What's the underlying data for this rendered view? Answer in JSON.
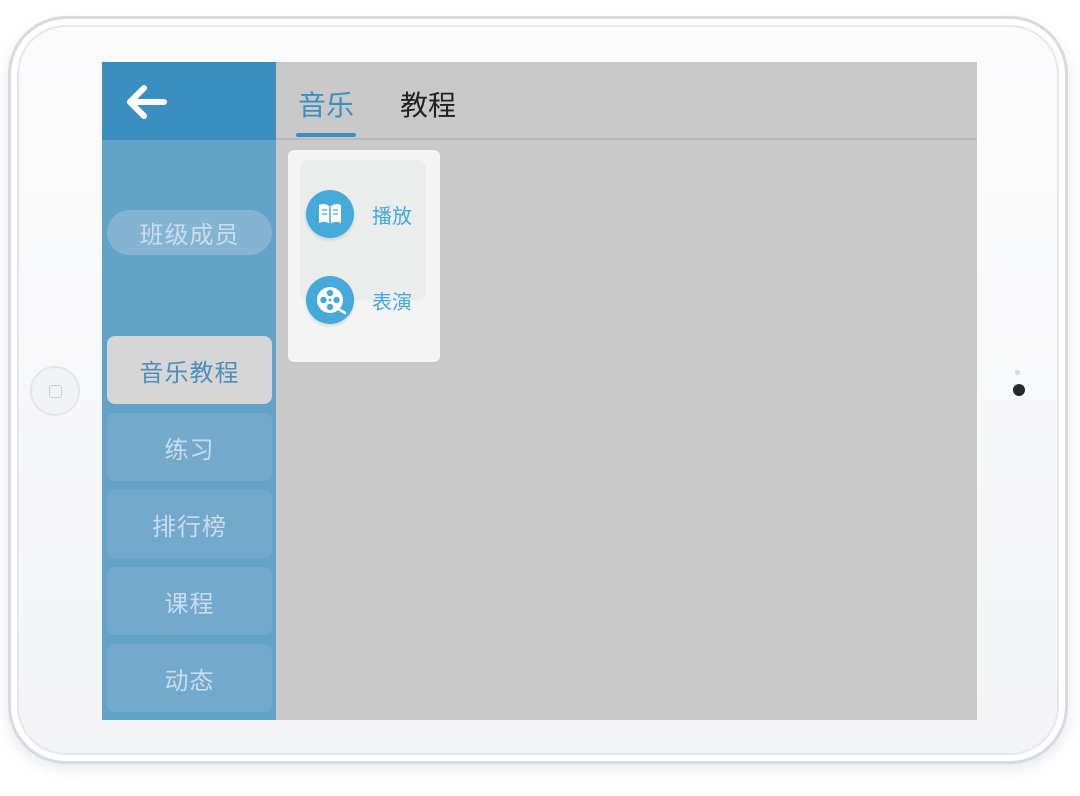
{
  "sidebar": {
    "back_icon": "arrow-left-icon",
    "member_button": "班级成员",
    "items": [
      {
        "label": "音乐教程",
        "active": true
      },
      {
        "label": "练习",
        "active": false
      },
      {
        "label": "排行榜",
        "active": false
      },
      {
        "label": "课程",
        "active": false
      },
      {
        "label": "动态",
        "active": false
      }
    ]
  },
  "tabs": [
    {
      "label": "音乐",
      "active": true
    },
    {
      "label": "教程",
      "active": false
    }
  ],
  "popup": {
    "actions": [
      {
        "label": "播放",
        "icon": "book-icon"
      },
      {
        "label": "表演",
        "icon": "film-reel-icon"
      }
    ]
  },
  "colors": {
    "accent": "#3b8fc0",
    "sidebar_bg": "#64a3c8",
    "content_bg": "#c9c9c9",
    "popup_icon": "#45a9da"
  }
}
